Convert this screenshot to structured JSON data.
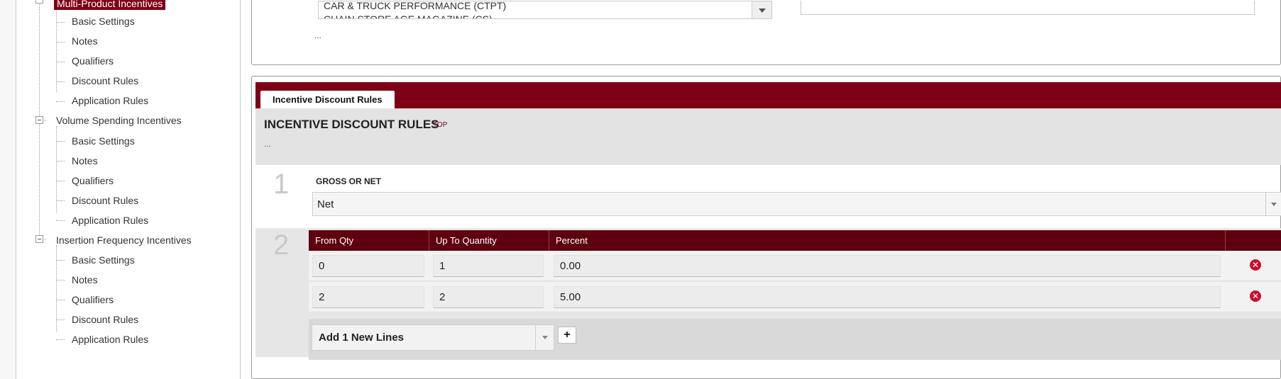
{
  "tree": {
    "groups": [
      {
        "label": "Multi-Product Incentives",
        "selected": true,
        "children": [
          "Basic Settings",
          "Notes",
          "Qualifiers",
          "Discount Rules",
          "Application Rules"
        ]
      },
      {
        "label": "Volume Spending Incentives",
        "selected": false,
        "children": [
          "Basic Settings",
          "Notes",
          "Qualifiers",
          "Discount Rules",
          "Application Rules"
        ]
      },
      {
        "label": "Insertion Frequency Incentives",
        "selected": false,
        "children": [
          "Basic Settings",
          "Notes",
          "Qualifiers",
          "Discount Rules",
          "Application Rules"
        ]
      }
    ]
  },
  "top_panel": {
    "list_options": [
      "CAR & TRUCK PERFORMANCE (CTPT)",
      "CHAIN STORE AGE MAGAZINE (CS)"
    ],
    "ellipsis": "..."
  },
  "discount_section": {
    "tab_label": "Incentive Discount Rules",
    "title": "INCENTIVE DISCOUNT RULES",
    "top_link": "TOP",
    "ellipsis": "...",
    "step1": {
      "number": "1",
      "label": "GROSS OR NET",
      "value": "Net"
    },
    "step2": {
      "number": "2",
      "columns": [
        "From Qty",
        "Up To Quantity",
        "Percent"
      ],
      "rows": [
        {
          "from": "0",
          "up_to": "1",
          "percent": "0.00"
        },
        {
          "from": "2",
          "up_to": "2",
          "percent": "5.00"
        }
      ],
      "add_lines_value": "Add 1 New Lines",
      "add_button": "+"
    }
  },
  "colors": {
    "brand": "#7d0016",
    "header_dark": "#5e0010",
    "delete": "#c8102e"
  },
  "icons": [
    "delete-icon",
    "dropdown-arrow-icon",
    "tree-collapse-icon"
  ]
}
